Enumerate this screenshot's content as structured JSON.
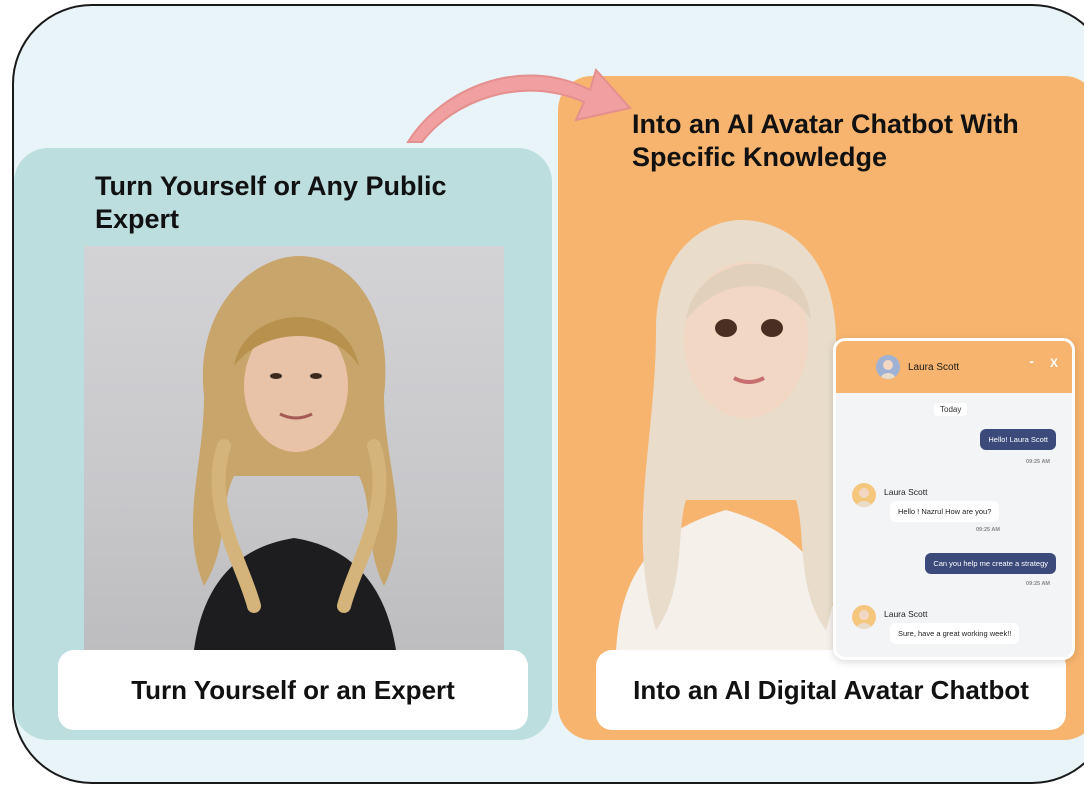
{
  "left": {
    "heading": "Turn Yourself or Any Public Expert",
    "caption": "Turn Yourself or an Expert"
  },
  "right": {
    "heading": "Into an AI Avatar Chatbot With Specific Knowledge",
    "caption": "Into an AI Digital Avatar Chatbot"
  },
  "chat": {
    "header_name": "Laura Scott",
    "minimize_label": "-",
    "close_label": "X",
    "day_label": "Today",
    "messages": [
      {
        "direction": "out",
        "text": "Hello! Laura Scott",
        "time": "09:25 AM"
      },
      {
        "direction": "in",
        "sender": "Laura Scott",
        "text": "Hello ! Nazrul How are you?",
        "time": "09:25 AM"
      },
      {
        "direction": "out",
        "text": "Can you help me create a strategy",
        "time": "09:25 AM"
      },
      {
        "direction": "in",
        "sender": "Laura Scott",
        "text": "Sure, have a great working week!!"
      }
    ]
  },
  "colors": {
    "frame_bg": "#e9f4f8",
    "left_panel": "#bcdedf",
    "right_panel": "#f7b46e",
    "arrow": "#f0a0a0",
    "bubble_out": "#3b4a7a"
  }
}
